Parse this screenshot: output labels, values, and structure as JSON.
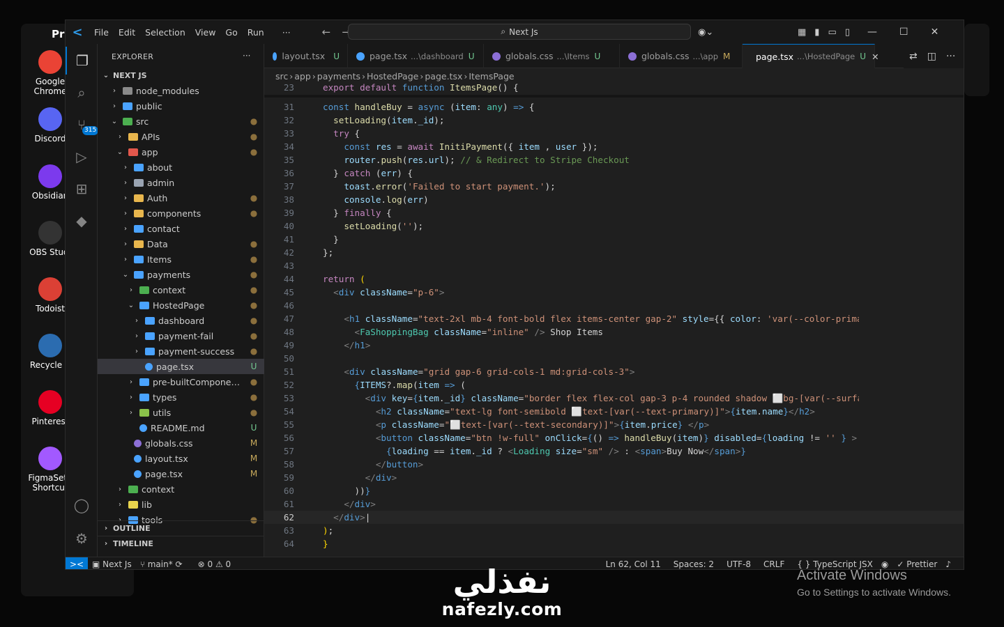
{
  "desktop": {
    "partial_label": "Pr",
    "icons": [
      {
        "label": "Google Chrome",
        "line1": "Google",
        "line2": "Chrome",
        "color": "#ea4335"
      },
      {
        "label": "Discord",
        "line1": "Discord",
        "line2": "",
        "color": "#5865f2"
      },
      {
        "label": "Obsidian",
        "line1": "Obsidian",
        "line2": "",
        "color": "#7c3aed"
      },
      {
        "label": "OBS Studio",
        "line1": "OBS Studi",
        "line2": "",
        "color": "#333"
      },
      {
        "label": "Todoist",
        "line1": "Todoist",
        "line2": "",
        "color": "#db4035"
      },
      {
        "label": "Recycle Bin",
        "line1": "Recycle B",
        "line2": "",
        "color": "#2b6cb0"
      },
      {
        "label": "Pinterest",
        "line1": "Pinterest",
        "line2": "",
        "color": "#e60023"
      },
      {
        "label": "FigmaSetup Shortcut",
        "line1": "FigmaSetu",
        "line2": "Shortcut",
        "color": "#a259ff"
      }
    ]
  },
  "titlebar": {
    "menu": [
      "File",
      "Edit",
      "Selection",
      "View",
      "Go",
      "Run",
      "···"
    ],
    "command_center": "Next Js"
  },
  "sidebar": {
    "title": "EXPLORER",
    "more": "···",
    "root": "NEXT JS",
    "tree": [
      {
        "name": "node_modules",
        "depth": 1,
        "chev": "›",
        "color": "#8a8a8a",
        "status": "",
        "scolor": ""
      },
      {
        "name": "public",
        "depth": 1,
        "chev": "›",
        "color": "#4aa3ff",
        "status": "",
        "scolor": ""
      },
      {
        "name": "src",
        "depth": 1,
        "chev": "⌄",
        "color": "#4caf50",
        "status": "●",
        "scolor": "#8b6f3c"
      },
      {
        "name": "APIs",
        "depth": 2,
        "chev": "›",
        "color": "#e8b64d",
        "status": "●",
        "scolor": "#8b6f3c"
      },
      {
        "name": "app",
        "depth": 2,
        "chev": "⌄",
        "color": "#e2574c",
        "status": "●",
        "scolor": "#8b6f3c"
      },
      {
        "name": "about",
        "depth": 3,
        "chev": "›",
        "color": "#4aa3ff",
        "status": "",
        "scolor": ""
      },
      {
        "name": "admin",
        "depth": 3,
        "chev": "›",
        "color": "#9aa4b2",
        "status": "",
        "scolor": ""
      },
      {
        "name": "Auth",
        "depth": 3,
        "chev": "›",
        "color": "#e8b64d",
        "status": "●",
        "scolor": "#8b6f3c"
      },
      {
        "name": "components",
        "depth": 3,
        "chev": "›",
        "color": "#e8b64d",
        "status": "●",
        "scolor": "#8b6f3c"
      },
      {
        "name": "contact",
        "depth": 3,
        "chev": "›",
        "color": "#4aa3ff",
        "status": "",
        "scolor": ""
      },
      {
        "name": "Data",
        "depth": 3,
        "chev": "›",
        "color": "#e8b64d",
        "status": "●",
        "scolor": "#8b6f3c"
      },
      {
        "name": "Items",
        "depth": 3,
        "chev": "›",
        "color": "#4aa3ff",
        "status": "●",
        "scolor": "#8b6f3c"
      },
      {
        "name": "payments",
        "depth": 3,
        "chev": "⌄",
        "color": "#4aa3ff",
        "status": "●",
        "scolor": "#8b6f3c"
      },
      {
        "name": "context",
        "depth": 4,
        "chev": "›",
        "color": "#4caf50",
        "status": "●",
        "scolor": "#8b6f3c"
      },
      {
        "name": "HostedPage",
        "depth": 4,
        "chev": "⌄",
        "color": "#4aa3ff",
        "status": "●",
        "scolor": "#8b6f3c"
      },
      {
        "name": "dashboard",
        "depth": 5,
        "chev": "›",
        "color": "#4aa3ff",
        "status": "●",
        "scolor": "#8b6f3c"
      },
      {
        "name": "payment-fail",
        "depth": 5,
        "chev": "›",
        "color": "#4aa3ff",
        "status": "●",
        "scolor": "#8b6f3c"
      },
      {
        "name": "payment-success",
        "depth": 5,
        "chev": "›",
        "color": "#4aa3ff",
        "status": "●",
        "scolor": "#8b6f3c"
      },
      {
        "name": "page.tsx",
        "depth": 5,
        "chev": "",
        "color": "#4aa3ff",
        "status": "U",
        "scolor": "#73c991",
        "sel": true
      },
      {
        "name": "pre-builtComponen...",
        "depth": 4,
        "chev": "›",
        "color": "#4aa3ff",
        "status": "●",
        "scolor": "#8b6f3c"
      },
      {
        "name": "types",
        "depth": 4,
        "chev": "›",
        "color": "#4aa3ff",
        "status": "●",
        "scolor": "#8b6f3c"
      },
      {
        "name": "utils",
        "depth": 4,
        "chev": "›",
        "color": "#8bc34a",
        "status": "●",
        "scolor": "#8b6f3c"
      },
      {
        "name": "README.md",
        "depth": 4,
        "chev": "",
        "color": "#4aa3ff",
        "status": "U",
        "scolor": "#73c991"
      },
      {
        "name": "globals.css",
        "depth": 3,
        "chev": "",
        "color": "#8c6fd6",
        "status": "M",
        "scolor": "#c7a95b"
      },
      {
        "name": "layout.tsx",
        "depth": 3,
        "chev": "",
        "color": "#4aa3ff",
        "status": "M",
        "scolor": "#c7a95b"
      },
      {
        "name": "page.tsx",
        "depth": 3,
        "chev": "",
        "color": "#4aa3ff",
        "status": "M",
        "scolor": "#c7a95b"
      },
      {
        "name": "context",
        "depth": 2,
        "chev": "›",
        "color": "#4caf50",
        "status": "",
        "scolor": ""
      },
      {
        "name": "lib",
        "depth": 2,
        "chev": "›",
        "color": "#e8d44d",
        "status": "",
        "scolor": ""
      },
      {
        "name": "tools",
        "depth": 2,
        "chev": "›",
        "color": "#4aa3ff",
        "status": "●",
        "scolor": "#8b6f3c"
      }
    ],
    "outline": "OUTLINE",
    "timeline": "TIMELINE"
  },
  "tabs": [
    {
      "name": "layout.tsx",
      "desc": "",
      "status": "U",
      "color": "#4aa3ff",
      "scolor": "#73c991",
      "active": false
    },
    {
      "name": "page.tsx",
      "desc": "...\\dashboard",
      "status": "U",
      "color": "#4aa3ff",
      "scolor": "#73c991",
      "active": false
    },
    {
      "name": "globals.css",
      "desc": "...\\Items",
      "status": "U",
      "color": "#8c6fd6",
      "scolor": "#73c991",
      "active": false
    },
    {
      "name": "globals.css",
      "desc": "...\\app",
      "status": "M",
      "color": "#8c6fd6",
      "scolor": "#c7a95b",
      "active": false
    },
    {
      "name": "page.tsx",
      "desc": "...\\HostedPage",
      "status": "U",
      "color": "#4aa3ff",
      "scolor": "#73c991",
      "active": true
    }
  ],
  "breadcrumb": [
    "src",
    "app",
    "payments",
    "HostedPage",
    "page.tsx",
    "ItemsPage"
  ],
  "editor": {
    "current_line": 62,
    "lines": [
      {
        "n": 23,
        "html": "<span class='kc'>export</span> <span class='kc'>default</span> <span class='kw'>function</span> <span class='fn'>ItemsPage</span><span class='tx'>() {</span>"
      },
      {
        "n": 31,
        "html": "<span class='kw'>const</span> <span class='fn'>handleBuy</span> <span class='tx'>=</span> <span class='kw'>async</span> <span class='tx'>(</span><span class='vr'>item</span><span class='tx'>:</span> <span class='ty'>any</span><span class='tx'>)</span> <span class='kw'>=&gt;</span> <span class='tx'>{</span>"
      },
      {
        "n": 32,
        "html": "  <span class='fn'>setLoading</span><span class='tx'>(</span><span class='vr'>item</span><span class='tx'>.</span><span class='vr'>_id</span><span class='tx'>);</span>"
      },
      {
        "n": 33,
        "html": "  <span class='kc'>try</span> <span class='tx'>{</span>"
      },
      {
        "n": 34,
        "html": "    <span class='kw'>const</span> <span class='vr'>res</span> <span class='tx'>=</span> <span class='kc'>await</span> <span class='fn'>InitiPayment</span><span class='tx'>({</span> <span class='vr'>item</span> <span class='tx'>,</span> <span class='vr'>user</span> <span class='tx'>});</span>"
      },
      {
        "n": 35,
        "html": "    <span class='vr'>router</span><span class='tx'>.</span><span class='fn'>push</span><span class='tx'>(</span><span class='vr'>res</span><span class='tx'>.</span><span class='vr'>url</span><span class='tx'>);</span> <span class='cm'>// &amp; Redirect to Stripe Checkout</span>"
      },
      {
        "n": 36,
        "html": "  <span class='tx'>}</span> <span class='kc'>catch</span> <span class='tx'>(</span><span class='vr'>err</span><span class='tx'>) {</span>"
      },
      {
        "n": 37,
        "html": "    <span class='vr'>toast</span><span class='tx'>.</span><span class='fn'>error</span><span class='tx'>(</span><span class='st'>'Failed to start payment.'</span><span class='tx'>);</span>"
      },
      {
        "n": 38,
        "html": "    <span class='vr'>console</span><span class='tx'>.</span><span class='fn'>log</span><span class='tx'>(</span><span class='vr'>err</span><span class='tx'>)</span>"
      },
      {
        "n": 39,
        "html": "  <span class='tx'>}</span> <span class='kc'>finally</span> <span class='tx'>{</span>"
      },
      {
        "n": 40,
        "html": "    <span class='fn'>setLoading</span><span class='tx'>(</span><span class='st'>''</span><span class='tx'>);</span>"
      },
      {
        "n": 41,
        "html": "  <span class='tx'>}</span>"
      },
      {
        "n": 42,
        "html": "<span class='tx'>};</span>"
      },
      {
        "n": 43,
        "html": ""
      },
      {
        "n": 44,
        "html": "<span class='kc'>return</span> <span class='br'>(</span>"
      },
      {
        "n": 45,
        "html": "  <span class='pn'>&lt;</span><span class='tg'>div</span> <span class='vr'>className</span><span class='tx'>=</span><span class='st'>\"p-6\"</span><span class='pn'>&gt;</span>"
      },
      {
        "n": 46,
        "html": ""
      },
      {
        "n": 47,
        "html": "    <span class='pn'>&lt;</span><span class='tg'>h1</span> <span class='vr'>className</span><span class='tx'>=</span><span class='st'>\"text-2xl mb-4 font-bold flex items-center gap-2\"</span> <span class='vr'>style</span><span class='tx'>={{</span> <span class='vr'>color</span><span class='tx'>:</span> <span class='st'>'var(--color-primar</span>"
      },
      {
        "n": 48,
        "html": "      <span class='pn'>&lt;</span><span class='ty'>FaShoppingBag</span> <span class='vr'>className</span><span class='tx'>=</span><span class='st'>\"inline\"</span> <span class='pn'>/&gt;</span><span class='tx'> Shop Items</span>"
      },
      {
        "n": 49,
        "html": "    <span class='pn'>&lt;/</span><span class='tg'>h1</span><span class='pn'>&gt;</span>"
      },
      {
        "n": 50,
        "html": ""
      },
      {
        "n": 51,
        "html": "    <span class='pn'>&lt;</span><span class='tg'>div</span> <span class='vr'>className</span><span class='tx'>=</span><span class='st'>\"grid gap-6 grid-cols-1 md:grid-cols-3\"</span><span class='pn'>&gt;</span>"
      },
      {
        "n": 52,
        "html": "      <span class='kw'>{</span><span class='vr'>ITEMS</span><span class='tx'>?.</span><span class='fn'>map</span><span class='tx'>(</span><span class='vr'>item</span> <span class='kw'>=&gt;</span> <span class='tx'>(</span>"
      },
      {
        "n": 53,
        "html": "        <span class='pn'>&lt;</span><span class='tg'>div</span> <span class='vr'>key</span><span class='tx'>=</span><span class='kw'>{</span><span class='vr'>item</span><span class='tx'>.</span><span class='vr'>_id</span><span class='kw'>}</span> <span class='vr'>className</span><span class='tx'>=</span><span class='st'>\"border flex flex-col gap-3 p-4 rounded shadow ⬜bg-[var(--surfac</span>"
      },
      {
        "n": 54,
        "html": "          <span class='pn'>&lt;</span><span class='tg'>h2</span> <span class='vr'>className</span><span class='tx'>=</span><span class='st'>\"text-lg font-semibold ⬜text-[var(--text-primary)]\"</span><span class='pn'>&gt;</span><span class='kw'>{</span><span class='vr'>item</span><span class='tx'>.</span><span class='vr'>name</span><span class='kw'>}</span><span class='pn'>&lt;/</span><span class='tg'>h2</span><span class='pn'>&gt;</span>"
      },
      {
        "n": 55,
        "html": "          <span class='pn'>&lt;</span><span class='tg'>p</span> <span class='vr'>className</span><span class='tx'>=</span><span class='st'>\"⬜text-[var(--text-secondary)]\"</span><span class='pn'>&gt;</span><span class='kw'>{</span><span class='vr'>item</span><span class='tx'>.</span><span class='vr'>price</span><span class='kw'>}</span> <span class='pn'>&lt;/</span><span class='tg'>p</span><span class='pn'>&gt;</span>"
      },
      {
        "n": 56,
        "html": "          <span class='pn'>&lt;</span><span class='tg'>button</span> <span class='vr'>className</span><span class='tx'>=</span><span class='st'>\"btn !w-full\"</span> <span class='vr'>onClick</span><span class='tx'>=</span><span class='kw'>{</span><span class='tx'>()</span> <span class='kw'>=&gt;</span> <span class='fn'>handleBuy</span><span class='tx'>(</span><span class='vr'>item</span><span class='tx'>)</span><span class='kw'>}</span> <span class='vr'>disabled</span><span class='tx'>=</span><span class='kw'>{</span><span class='vr'>loading</span> <span class='tx'>!=</span> <span class='st'>''</span> <span class='kw'>}</span> <span class='pn'>&gt;</span>"
      },
      {
        "n": 57,
        "html": "            <span class='kw'>{</span><span class='vr'>loading</span> <span class='tx'>==</span> <span class='vr'>item</span><span class='tx'>.</span><span class='vr'>_id</span> <span class='tx'>?</span> <span class='pn'>&lt;</span><span class='ty'>Loading</span> <span class='vr'>size</span><span class='tx'>=</span><span class='st'>\"sm\"</span> <span class='pn'>/&gt;</span> <span class='tx'>:</span> <span class='pn'>&lt;</span><span class='tg'>span</span><span class='pn'>&gt;</span><span class='tx'>Buy Now</span><span class='pn'>&lt;/</span><span class='tg'>span</span><span class='pn'>&gt;</span><span class='kw'>}</span>"
      },
      {
        "n": 58,
        "html": "          <span class='pn'>&lt;/</span><span class='tg'>button</span><span class='pn'>&gt;</span>"
      },
      {
        "n": 59,
        "html": "        <span class='pn'>&lt;/</span><span class='tg'>div</span><span class='pn'>&gt;</span>"
      },
      {
        "n": 60,
        "html": "      <span class='tx'>))</span><span class='kw'>}</span>"
      },
      {
        "n": 61,
        "html": "    <span class='pn'>&lt;/</span><span class='tg'>div</span><span class='pn'>&gt;</span>"
      },
      {
        "n": 62,
        "html": "  <span class='pn'>&lt;/</span><span class='tg'>div</span><span class='pn'>&gt;</span><span class='tx'>|</span>"
      },
      {
        "n": 63,
        "html": "<span class='br'>)</span><span class='tx'>;</span>"
      },
      {
        "n": 64,
        "html": "<span class='br'>}</span>"
      }
    ]
  },
  "statusbar": {
    "remote": "><",
    "project": "Next Js",
    "branch": "main*",
    "sync": "⟳",
    "errors": "0",
    "warnings": "0",
    "position": "Ln 62, Col 11",
    "spaces": "Spaces: 2",
    "encoding": "UTF-8",
    "eol": "CRLF",
    "language": "TypeScript JSX",
    "formatter": "Prettier"
  },
  "watermark": {
    "title": "Activate Windows",
    "subtitle": "Go to Settings to activate Windows."
  },
  "brand_overlay": {
    "arabic": "نفذلي",
    "latin": "nafezly.com"
  }
}
